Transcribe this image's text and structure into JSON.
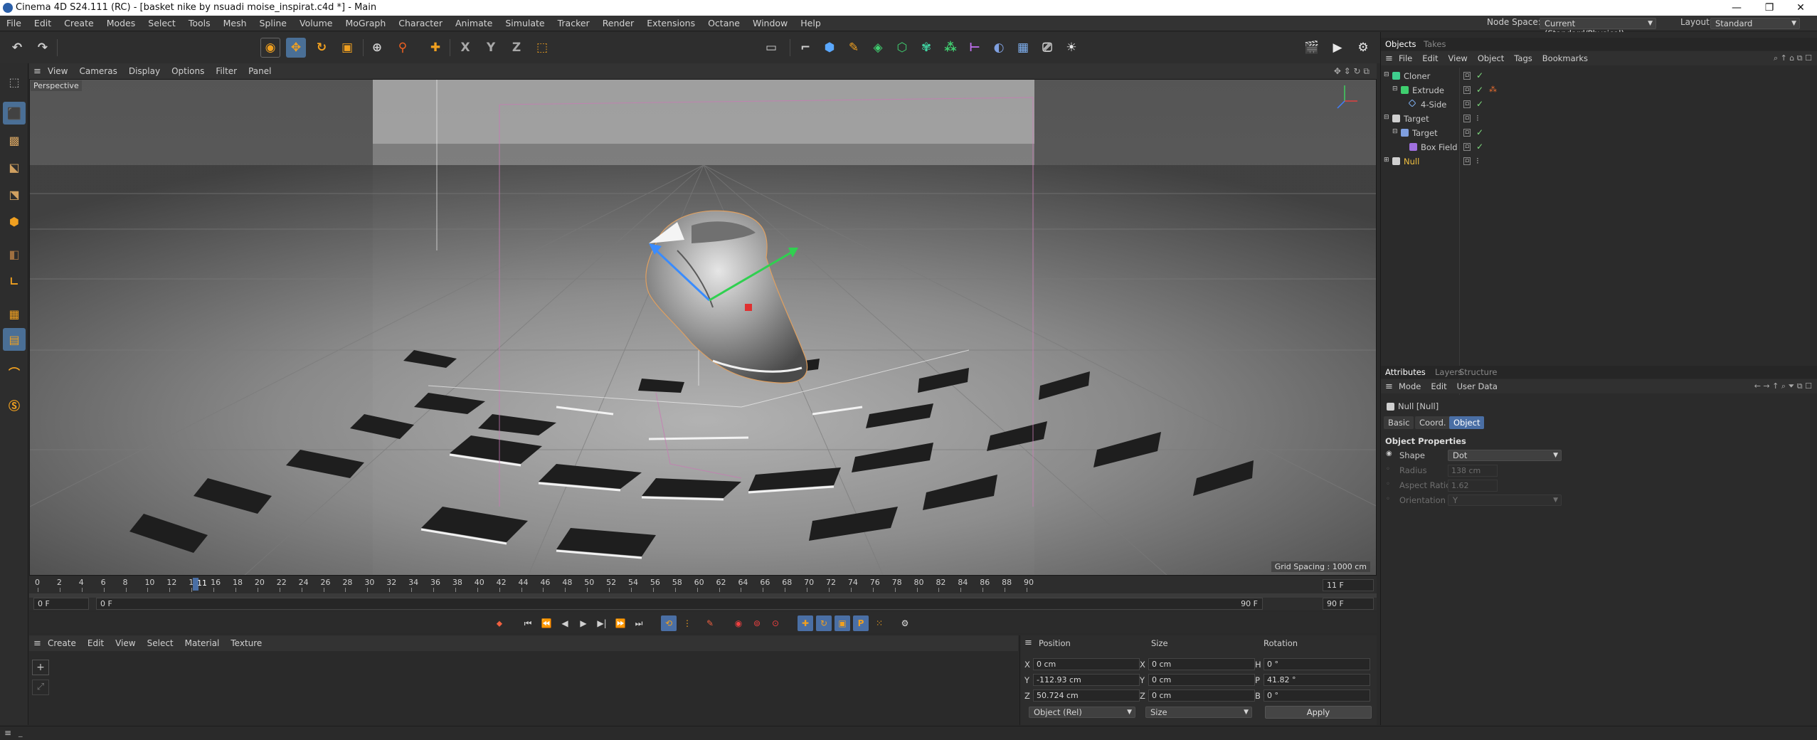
{
  "titlebar": {
    "title": "Cinema 4D S24.111 (RC) - [basket nike by nsuadi moise_inspirat.c4d *] - Main",
    "minimize": "—",
    "restore": "❐",
    "close": "✕"
  },
  "menubar": {
    "items": [
      "File",
      "Edit",
      "Create",
      "Modes",
      "Select",
      "Tools",
      "Mesh",
      "Spline",
      "Volume",
      "MoGraph",
      "Character",
      "Animate",
      "Simulate",
      "Tracker",
      "Render",
      "Extensions",
      "Octane",
      "Window",
      "Help"
    ],
    "node_space_label": "Node Space:",
    "node_space_value": "Current (Standard/Physical)",
    "layout_label": "Layout:",
    "layout_value": "Standard"
  },
  "viewport": {
    "menu": [
      "View",
      "Cameras",
      "Display",
      "Options",
      "Filter",
      "Panel"
    ],
    "label": "Perspective",
    "grid_spacing": "Grid Spacing : 1000 cm"
  },
  "timeline": {
    "ticks": [
      "0",
      "2",
      "4",
      "6",
      "8",
      "10",
      "12",
      "14",
      "16",
      "18",
      "20",
      "22",
      "24",
      "26",
      "28",
      "30",
      "32",
      "34",
      "36",
      "38",
      "40",
      "42",
      "44",
      "46",
      "48",
      "50",
      "52",
      "54",
      "56",
      "58",
      "60",
      "62",
      "64",
      "66",
      "68",
      "70",
      "72",
      "74",
      "76",
      "78",
      "80",
      "82",
      "84",
      "86",
      "88",
      "90"
    ],
    "current_tick": "11",
    "current_frame": "11 F",
    "start_frame": "0 F",
    "min_frame": "0 F",
    "max_frame": "90 F",
    "end_frame": "90 F"
  },
  "material_manager": {
    "menu": [
      "Create",
      "Edit",
      "View",
      "Select",
      "Material",
      "Texture"
    ]
  },
  "coordinates": {
    "headers": {
      "position": "Position",
      "size": "Size",
      "rotation": "Rotation"
    },
    "position": {
      "x": "0 cm",
      "y": "-112.93 cm",
      "z": "50.724 cm"
    },
    "size": {
      "x": "0 cm",
      "y": "0 cm",
      "z": "0 cm"
    },
    "rotation": {
      "h": "0 °",
      "p": "41.82 °",
      "b": "0 °"
    },
    "axis_labels": {
      "x": "X",
      "y": "Y",
      "z": "Z",
      "h": "H",
      "p": "P",
      "b": "B"
    },
    "mode_value": "Object (Rel)",
    "size_mode_value": "Size",
    "apply_label": "Apply"
  },
  "objects_panel": {
    "tabs": [
      "Objects",
      "Takes"
    ],
    "menu": [
      "File",
      "Edit",
      "View",
      "Object",
      "Tags",
      "Bookmarks"
    ],
    "items": [
      {
        "name": "Cloner"
      },
      {
        "name": "Extrude"
      },
      {
        "name": "4-Side"
      },
      {
        "name": "Target"
      },
      {
        "name": "Target"
      },
      {
        "name": "Box Field"
      },
      {
        "name": "Null"
      }
    ]
  },
  "attributes_panel": {
    "tabs": [
      "Attributes",
      "Layers",
      "Structure"
    ],
    "menu": [
      "Mode",
      "Edit",
      "User Data"
    ],
    "object_title": "Null [Null]",
    "subtabs": [
      "Basic",
      "Coord.",
      "Object"
    ],
    "section_title": "Object Properties",
    "properties": [
      {
        "label": "Shape",
        "value": "Dot"
      },
      {
        "label": "Radius",
        "value": "138 cm"
      },
      {
        "label": "Aspect Ratio",
        "value": "1.62"
      },
      {
        "label": "Orientation",
        "value": "Y"
      }
    ]
  },
  "colors": {
    "accent": "#4a6fa5",
    "selected_object": "#f0c040",
    "check_green": "#7fdc7f"
  }
}
